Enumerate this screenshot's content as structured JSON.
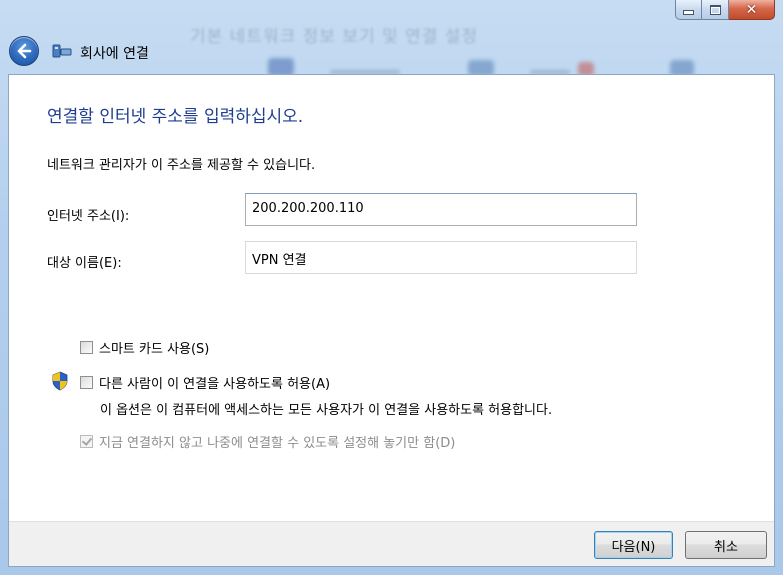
{
  "window": {
    "background_title": "기본 네트워크 정보 보기 및 연결 설정",
    "nav_title": "회사에 연결"
  },
  "main": {
    "heading": "연결할 인터넷 주소를 입력하십시오.",
    "description": "네트워크 관리자가 이 주소를 제공할 수 있습니다.",
    "internet_address": {
      "label": "인터넷 주소(I):",
      "value": "200.200.200.110"
    },
    "destination_name": {
      "label": "대상 이름(E):",
      "value": "VPN 연결"
    },
    "options": {
      "smart_card": {
        "label": "스마트 카드 사용(S)",
        "checked": false
      },
      "allow_others": {
        "label": "다른 사람이 이 연결을 사용하도록 허용(A)",
        "checked": false,
        "description": "이 옵션은 이 컴퓨터에 액세스하는 모든 사용자가 이 연결을 사용하도록 허용합니다."
      },
      "dont_connect_now": {
        "label": "지금 연결하지 않고 나중에 연결할 수 있도록 설정해 놓기만 함(D)",
        "checked": true,
        "disabled": true
      }
    }
  },
  "footer": {
    "next_label": "다음(N)",
    "cancel_label": "취소"
  },
  "colors": {
    "heading": "#1e3d8f",
    "accent": "#3c7fb1",
    "close": "#c24a2c"
  },
  "icons": [
    "back-arrow-icon",
    "vpn-network-icon",
    "minimize-icon",
    "maximize-icon",
    "close-icon",
    "uac-shield-icon"
  ]
}
